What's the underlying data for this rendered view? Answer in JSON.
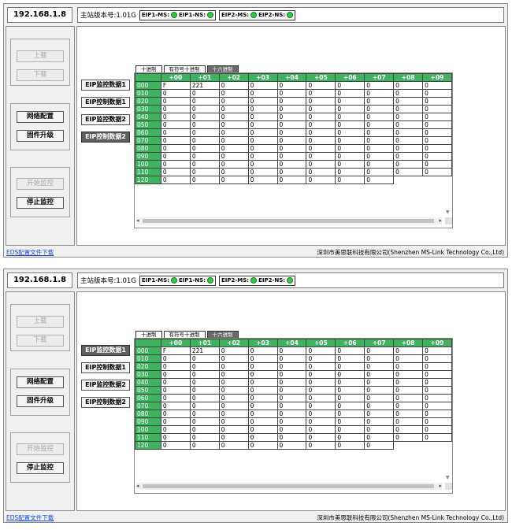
{
  "ip": "192.168.1.8",
  "firmware": "主站版本号:1.01G",
  "status": {
    "g1": {
      "ms": "EIP1-MS:",
      "ns": "EIP1-NS:"
    },
    "g2": {
      "ms": "EIP2-MS:",
      "ns": "EIP2-NS:"
    },
    "led_color": "#2ecc40"
  },
  "left": {
    "upload": "上载",
    "download": "下载",
    "net": "网络配置",
    "firmware_upgrade": "固件升级",
    "start_monitor": "开始监控",
    "stop_monitor": "停止监控"
  },
  "data_buttons": [
    "EIP监控数据1",
    "EIP控制数据1",
    "EIP监控数据2",
    "EIP控制数据2"
  ],
  "tabs": [
    "十进制",
    "有符号十进制",
    "十六进制"
  ],
  "active_tab_index": 2,
  "columns": [
    "+00",
    "+01",
    "+02",
    "+03",
    "+04",
    "+05",
    "+06",
    "+07",
    "+08",
    "+09"
  ],
  "rows": [
    {
      "label": "000",
      "values": [
        "F",
        "221",
        "0",
        "0",
        "0",
        "0",
        "0",
        "0",
        "0",
        "0"
      ]
    },
    {
      "label": "010",
      "values": [
        "0",
        "0",
        "0",
        "0",
        "0",
        "0",
        "0",
        "0",
        "0",
        "0"
      ]
    },
    {
      "label": "020",
      "values": [
        "0",
        "0",
        "0",
        "0",
        "0",
        "0",
        "0",
        "0",
        "0",
        "0"
      ]
    },
    {
      "label": "030",
      "values": [
        "0",
        "0",
        "0",
        "0",
        "0",
        "0",
        "0",
        "0",
        "0",
        "0"
      ]
    },
    {
      "label": "040",
      "values": [
        "0",
        "0",
        "0",
        "0",
        "0",
        "0",
        "0",
        "0",
        "0",
        "0"
      ]
    },
    {
      "label": "050",
      "values": [
        "0",
        "0",
        "0",
        "0",
        "0",
        "0",
        "0",
        "0",
        "0",
        "0"
      ]
    },
    {
      "label": "060",
      "values": [
        "0",
        "0",
        "0",
        "0",
        "0",
        "0",
        "0",
        "0",
        "0",
        "0"
      ]
    },
    {
      "label": "070",
      "values": [
        "0",
        "0",
        "0",
        "0",
        "0",
        "0",
        "0",
        "0",
        "0",
        "0"
      ]
    },
    {
      "label": "080",
      "values": [
        "0",
        "0",
        "0",
        "0",
        "0",
        "0",
        "0",
        "0",
        "0",
        "0"
      ]
    },
    {
      "label": "090",
      "values": [
        "0",
        "0",
        "0",
        "0",
        "0",
        "0",
        "0",
        "0",
        "0",
        "0"
      ]
    },
    {
      "label": "100",
      "values": [
        "0",
        "0",
        "0",
        "0",
        "0",
        "0",
        "0",
        "0",
        "0",
        "0"
      ]
    },
    {
      "label": "110",
      "values": [
        "0",
        "0",
        "0",
        "0",
        "0",
        "0",
        "0",
        "0",
        "0",
        "0"
      ]
    },
    {
      "label": "120",
      "values": [
        "0",
        "0",
        "0",
        "0",
        "0",
        "0",
        "0",
        "0"
      ]
    }
  ],
  "eds_link": "EDS配置文件下载",
  "company": "深圳市美思联科技有限公司(Shenzhen MS-Link Technology Co.,Ltd)",
  "panels": [
    {
      "active_data_button": 3
    },
    {
      "active_data_button": 0
    }
  ]
}
